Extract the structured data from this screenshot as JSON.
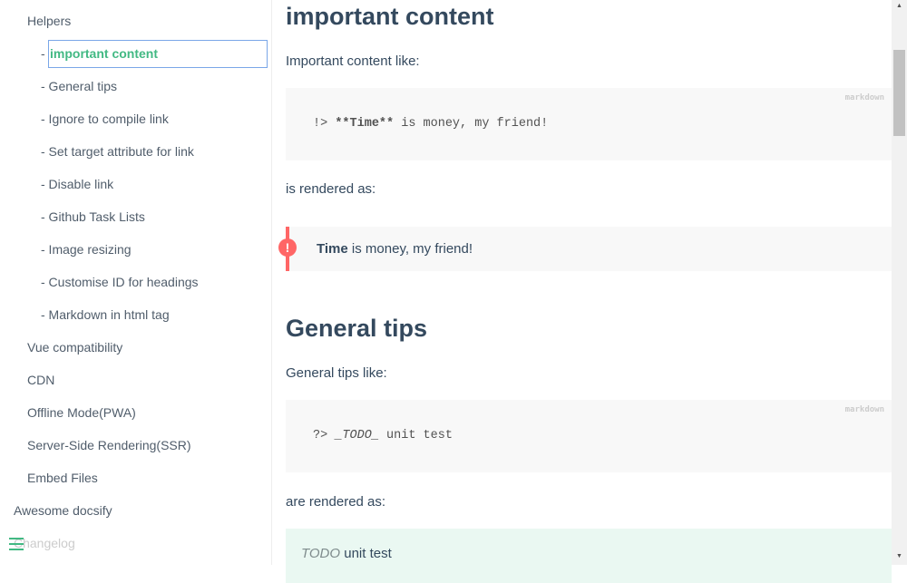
{
  "sidebar": {
    "helpers": "Helpers",
    "sub": [
      "- ",
      "important content",
      "- General tips",
      "- Ignore to compile link",
      "- Set target attribute for link",
      "- Disable link",
      "- Github Task Lists",
      "- Image resizing",
      "- Customise ID for headings",
      "- Markdown in html tag"
    ],
    "l1": [
      "Vue compatibility",
      "CDN",
      "Offline Mode(PWA)",
      "Server-Side Rendering(SSR)",
      "Embed Files"
    ],
    "awesome": "Awesome docsify",
    "changelog": "Changelog"
  },
  "main": {
    "h_important": "important content",
    "p_important": "Important content like:",
    "code1_lang": "markdown",
    "code1_pre": "!> ",
    "code1_bold": "**Time**",
    "code1_post": " is money, my friend!",
    "rendered1": "is rendered as:",
    "tip_bold": "Time",
    "tip_rest": " is money, my friend!",
    "tip_icon": "!",
    "h_general": "General tips",
    "p_general": "General tips like:",
    "code2_lang": "markdown",
    "code2_pre": "?> ",
    "code2_em": "_TODO_",
    "code2_post": " unit test",
    "rendered2": "are rendered as:",
    "warn_em": "TODO",
    "warn_rest": " unit test"
  },
  "colors": {
    "accent": "#42b983",
    "tip": "#ff6666"
  }
}
